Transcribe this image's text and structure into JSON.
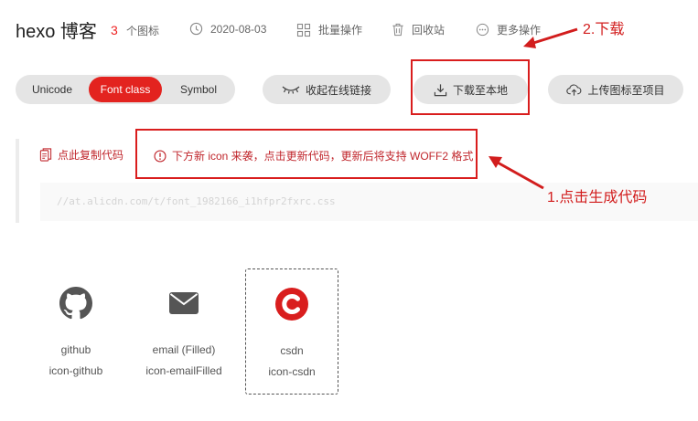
{
  "header": {
    "title": "hexo 博客",
    "icon_count": "3",
    "icon_count_label": "个图标",
    "date": "2020-08-03",
    "batch_label": "批量操作",
    "recycle_label": "回收站",
    "more_label": "更多操作"
  },
  "tabs": [
    {
      "label": "Unicode",
      "active": false
    },
    {
      "label": "Font class",
      "active": true
    },
    {
      "label": "Symbol",
      "active": false
    }
  ],
  "actions": {
    "collapse_link": "收起在线链接",
    "download": "下载至本地",
    "upload": "上传图标至项目"
  },
  "code_panel": {
    "copy_label": "点此复制代码",
    "notice": "下方新 icon 来袭，点击更新代码，更新后将支持 WOFF2 格式",
    "url": "//at.alicdn.com/t/font_1982166_i1hfpr2fxrc.css"
  },
  "annotations": {
    "step2": "2.下载",
    "step1": "1.点击生成代码"
  },
  "icons": [
    {
      "name": "github",
      "class": "icon-github",
      "icon": "github-icon"
    },
    {
      "name": "email (Filled)",
      "class": "icon-emailFilled",
      "icon": "email-icon"
    },
    {
      "name": "csdn",
      "class": "icon-csdn",
      "icon": "csdn-icon"
    }
  ],
  "colors": {
    "accent": "#e3231f",
    "annotation": "#d21d1d",
    "link": "#c0262c"
  }
}
